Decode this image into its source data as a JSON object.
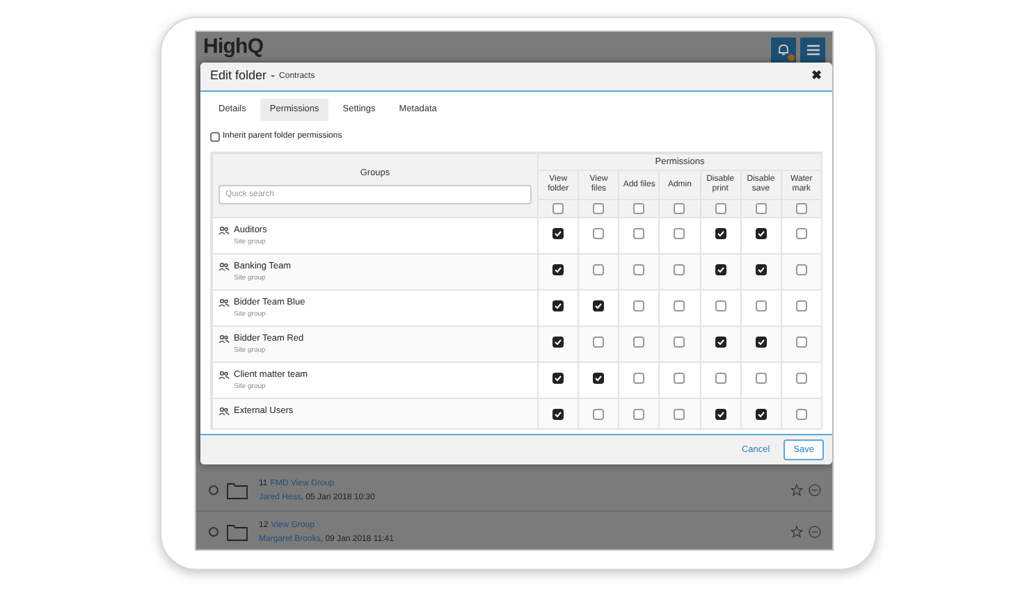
{
  "app_header": {
    "logo": "HighQ"
  },
  "background_items": [
    {
      "checked": false,
      "number": "11",
      "name": "FMD View Group",
      "author": "Jared Hess",
      "date": ", 05 Jan 2018 10:30"
    },
    {
      "checked": false,
      "number": "12",
      "name": "View Group",
      "author": "Margaret Brooks",
      "date": ", 09 Jan 2018 11:41"
    }
  ],
  "dialog": {
    "title": "Edit folder",
    "separator": "-",
    "subtitle": "Contracts",
    "close": "✖",
    "tabs": [
      {
        "label": "Details",
        "selected": false
      },
      {
        "label": "Permissions",
        "selected": true
      },
      {
        "label": "Settings",
        "selected": false
      },
      {
        "label": "Metadata",
        "selected": false
      }
    ],
    "inherit": {
      "label": "Inherit parent folder permissions",
      "checked": false
    },
    "table": {
      "groups_heading": "Groups",
      "search_placeholder": "Quick search",
      "permissions_heading": "Permissions",
      "columns": [
        {
          "label": "View folder",
          "checked": false
        },
        {
          "label": "View files",
          "checked": false
        },
        {
          "label": "Add files",
          "checked": false
        },
        {
          "label": "Admin",
          "checked": false
        },
        {
          "label": "Disable print",
          "checked": false
        },
        {
          "label": "Disable save",
          "checked": false
        },
        {
          "label": "Water mark",
          "checked": false
        }
      ],
      "rows": [
        {
          "name": "Auditors",
          "type": "Site group",
          "checks": [
            true,
            false,
            false,
            false,
            true,
            true,
            false
          ]
        },
        {
          "name": "Banking Team",
          "type": "Site group",
          "checks": [
            true,
            false,
            false,
            false,
            true,
            true,
            false
          ]
        },
        {
          "name": "Bidder Team Blue",
          "type": "Site group",
          "checks": [
            true,
            true,
            false,
            false,
            false,
            false,
            false
          ]
        },
        {
          "name": "Bidder Team Red",
          "type": "Site group",
          "checks": [
            true,
            false,
            false,
            false,
            true,
            true,
            false
          ]
        },
        {
          "name": "Client matter team",
          "type": "Site group",
          "checks": [
            true,
            true,
            false,
            false,
            false,
            false,
            false
          ]
        },
        {
          "name": "External Users",
          "checks": [
            true,
            false,
            false,
            false,
            true,
            true,
            false
          ]
        }
      ]
    },
    "buttons": [
      {
        "label": "Cancel",
        "kind": "link"
      },
      {
        "label": "Save",
        "kind": "outlined"
      }
    ]
  }
}
